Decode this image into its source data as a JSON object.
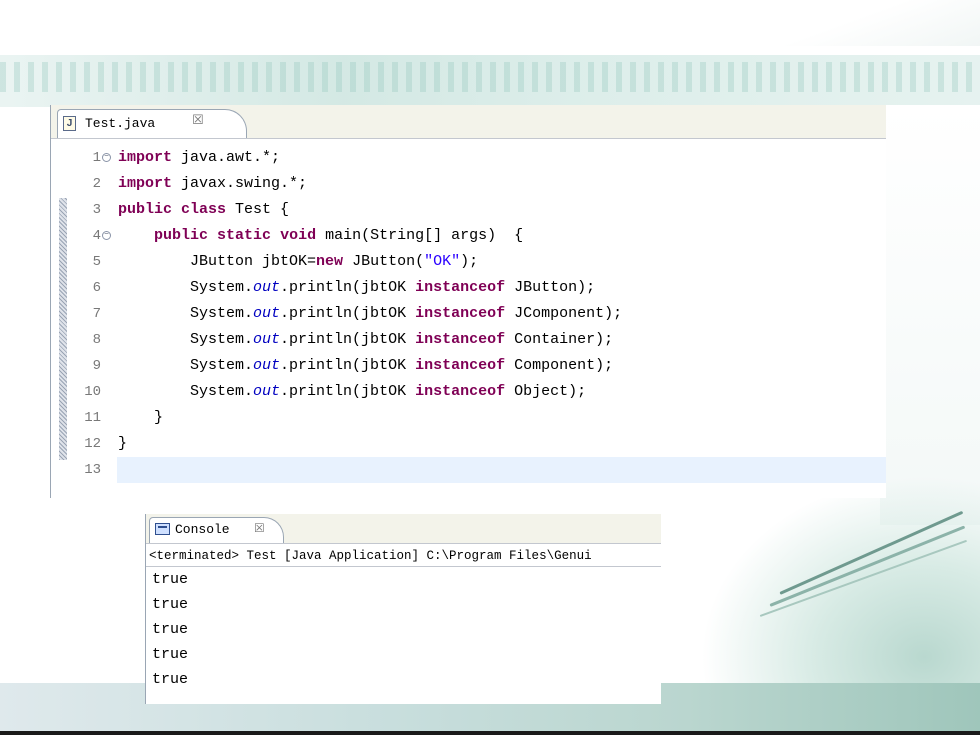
{
  "editor": {
    "tab_label": "Test.java",
    "tab_icon": "java-file-icon",
    "tab_icon_glyph": "J",
    "close_glyph": "☒",
    "lines": [
      {
        "num": "1",
        "fold": true,
        "tokens": [
          {
            "t": "import",
            "k": "kw"
          },
          {
            "t": " java.awt.*;"
          }
        ]
      },
      {
        "num": "2",
        "tokens": [
          {
            "t": "import",
            "k": "kw"
          },
          {
            "t": " javax.swing.*;"
          }
        ]
      },
      {
        "num": "3",
        "tokens": [
          {
            "t": "public",
            "k": "kw"
          },
          {
            "t": " "
          },
          {
            "t": "class",
            "k": "kw"
          },
          {
            "t": " Test {"
          }
        ]
      },
      {
        "num": "4",
        "fold": true,
        "tokens": [
          {
            "t": "    "
          },
          {
            "t": "public",
            "k": "kw"
          },
          {
            "t": " "
          },
          {
            "t": "static",
            "k": "kw"
          },
          {
            "t": " "
          },
          {
            "t": "void",
            "k": "kw"
          },
          {
            "t": " main(String[] args)  {"
          }
        ]
      },
      {
        "num": "5",
        "tokens": [
          {
            "t": "        JButton jbtOK="
          },
          {
            "t": "new",
            "k": "kw"
          },
          {
            "t": " JButton("
          },
          {
            "t": "\"OK\"",
            "k": "str"
          },
          {
            "t": ");"
          }
        ]
      },
      {
        "num": "6",
        "tokens": [
          {
            "t": "        System."
          },
          {
            "t": "out",
            "k": "fld"
          },
          {
            "t": ".println(jbtOK "
          },
          {
            "t": "instanceof",
            "k": "kw"
          },
          {
            "t": " JButton);"
          }
        ]
      },
      {
        "num": "7",
        "tokens": [
          {
            "t": "        System."
          },
          {
            "t": "out",
            "k": "fld"
          },
          {
            "t": ".println(jbtOK "
          },
          {
            "t": "instanceof",
            "k": "kw"
          },
          {
            "t": " JComponent);"
          }
        ]
      },
      {
        "num": "8",
        "tokens": [
          {
            "t": "        System."
          },
          {
            "t": "out",
            "k": "fld"
          },
          {
            "t": ".println(jbtOK "
          },
          {
            "t": "instanceof",
            "k": "kw"
          },
          {
            "t": " Container);"
          }
        ]
      },
      {
        "num": "9",
        "tokens": [
          {
            "t": "        System."
          },
          {
            "t": "out",
            "k": "fld"
          },
          {
            "t": ".println(jbtOK "
          },
          {
            "t": "instanceof",
            "k": "kw"
          },
          {
            "t": " Component);"
          }
        ]
      },
      {
        "num": "10",
        "tokens": [
          {
            "t": "        System."
          },
          {
            "t": "out",
            "k": "fld"
          },
          {
            "t": ".println(jbtOK "
          },
          {
            "t": "instanceof",
            "k": "kw"
          },
          {
            "t": " Object);"
          }
        ]
      },
      {
        "num": "11",
        "tokens": [
          {
            "t": "    }"
          }
        ]
      },
      {
        "num": "12",
        "tokens": [
          {
            "t": "}"
          }
        ]
      },
      {
        "num": "13",
        "current": true,
        "tokens": []
      }
    ]
  },
  "console": {
    "tab_label": "Console",
    "tab_icon": "console-icon",
    "close_glyph": "☒",
    "status": "<terminated> Test [Java Application] C:\\Program Files\\Genui",
    "output": [
      "true",
      "true",
      "true",
      "true",
      "true"
    ]
  },
  "colors": {
    "keyword": "#7f0055",
    "static_field": "#0000c0",
    "string": "#2a00ff",
    "current_line": "#e8f2fe"
  }
}
